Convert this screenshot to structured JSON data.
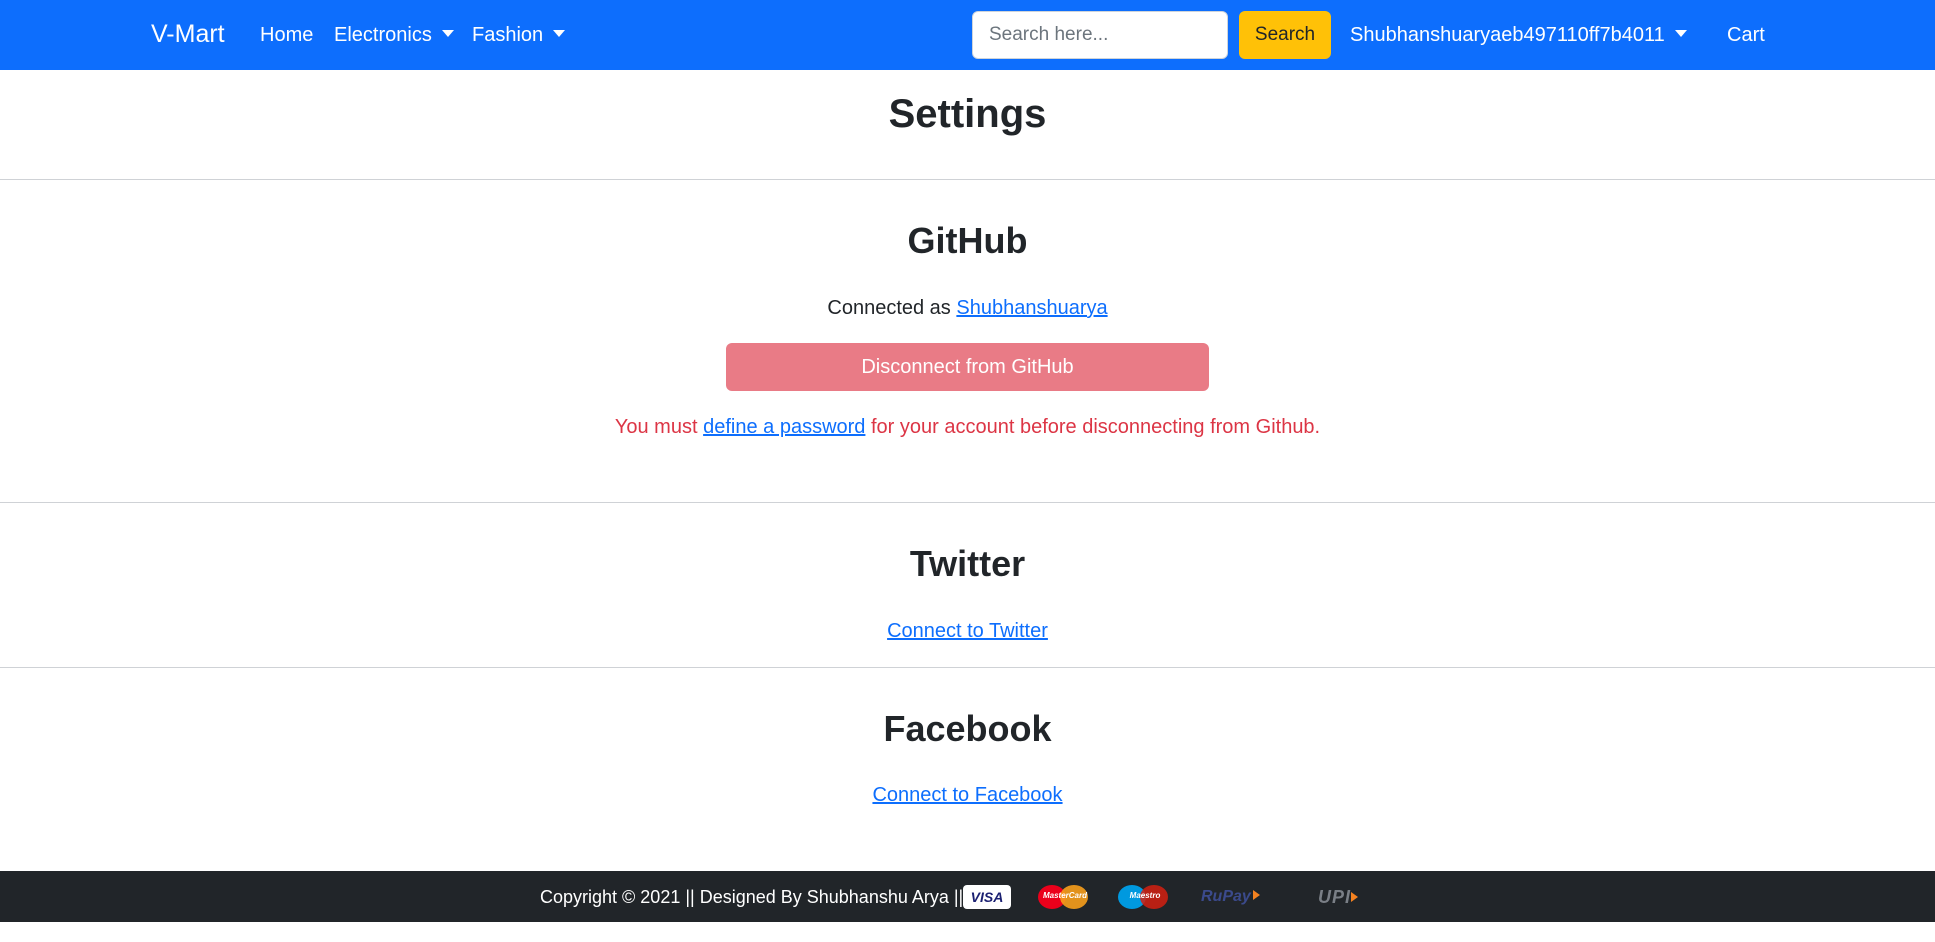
{
  "navbar": {
    "brand": "V-Mart",
    "items": [
      {
        "label": "Home"
      },
      {
        "label": "Electronics"
      },
      {
        "label": "Fashion"
      }
    ],
    "search": {
      "placeholder": "Search here...",
      "value": "",
      "button_label": "Search"
    },
    "user_label": "Shubhanshuaryaeb497110ff7b4011",
    "cart_label": "Cart"
  },
  "page": {
    "title": "Settings"
  },
  "github": {
    "title": "GitHub",
    "connected_prefix": "Connected as",
    "username": "Shubhanshuarya",
    "disconnect_label": "Disconnect from GitHub",
    "warning_prefix": "You must",
    "warning_link": "define a password",
    "warning_suffix": "for your account before disconnecting from Github."
  },
  "twitter": {
    "title": "Twitter",
    "connect_label": "Connect to Twitter"
  },
  "facebook": {
    "title": "Facebook",
    "connect_label": "Connect to Facebook"
  },
  "footer": {
    "text": "Copyright © 2021 || Designed By Shubhanshu Arya ||",
    "payment_icons": [
      "visa-icon",
      "mastercard-icon",
      "maestro-icon",
      "rupay-icon",
      "upi-icon"
    ],
    "logos": {
      "visa": "VISA",
      "mastercard": "MasterCard",
      "maestro": "Maestro",
      "rupay": "RuPay",
      "upi": "UPI"
    }
  },
  "colors": {
    "navbar": "#0d6efd",
    "search_button": "#ffc107",
    "danger": "#dc3545",
    "footer": "#212529"
  }
}
